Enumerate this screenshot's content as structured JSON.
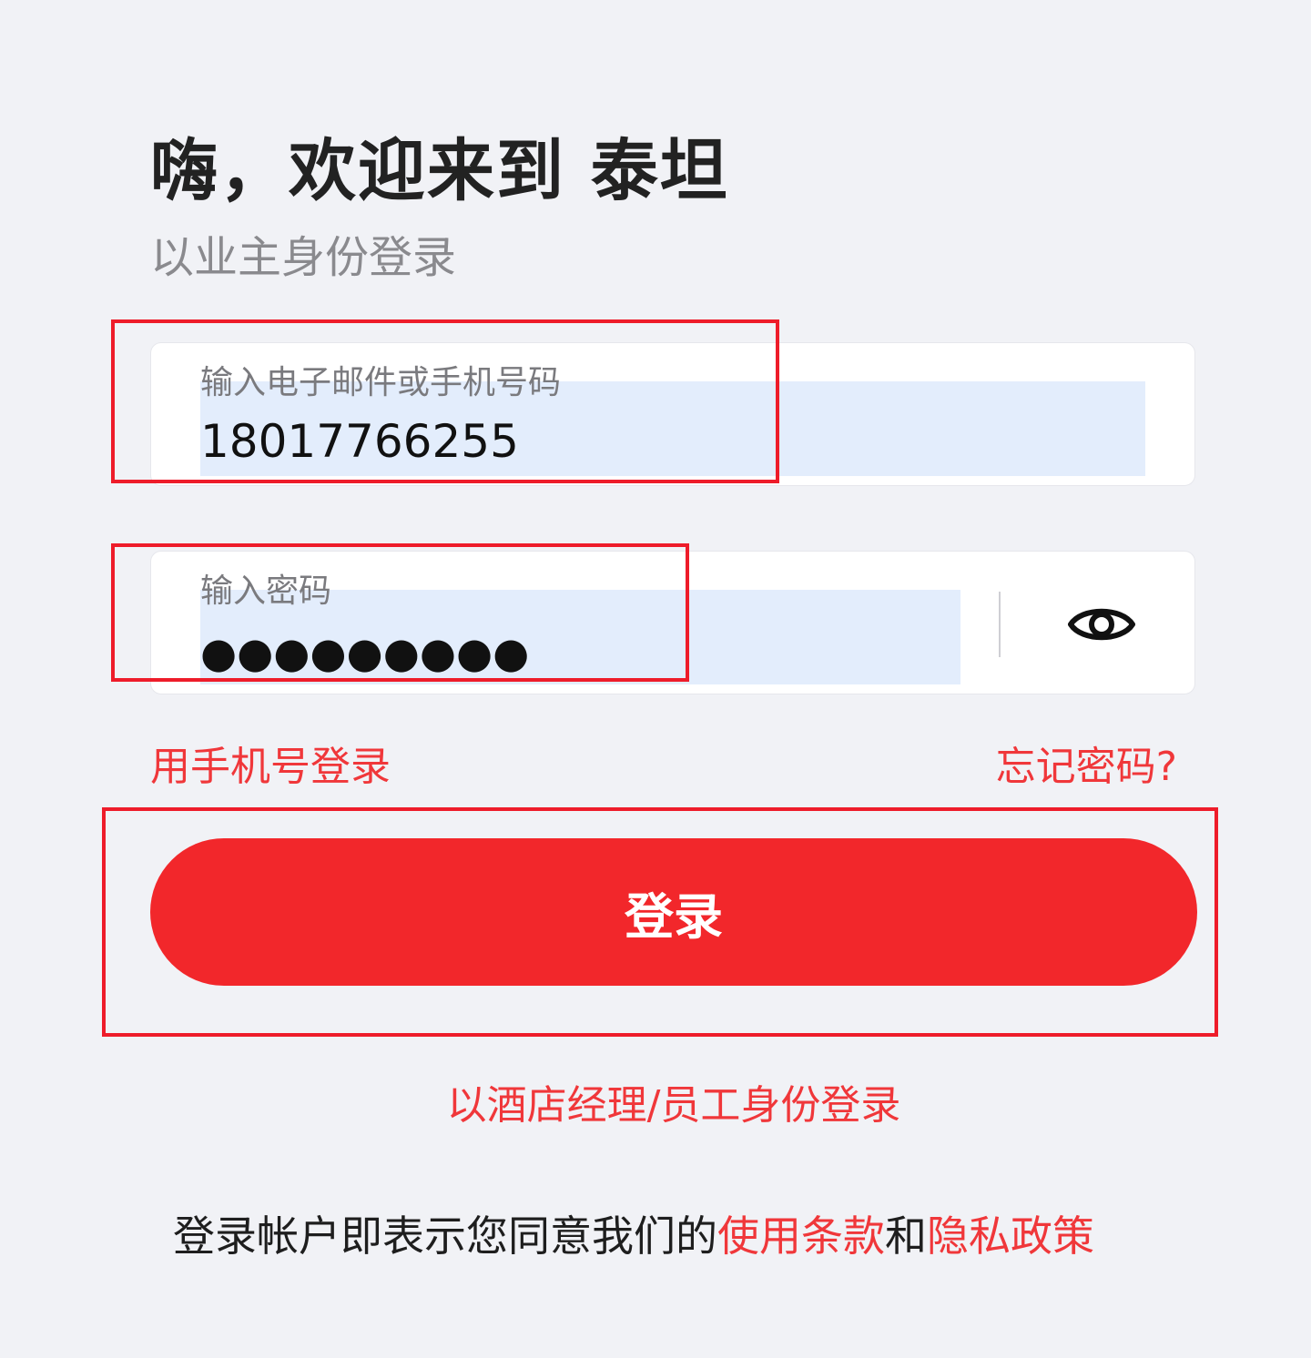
{
  "header": {
    "title": "嗨，欢迎来到 泰坦",
    "subtitle": "以业主身份登录"
  },
  "account_field": {
    "label": "输入电子邮件或手机号码",
    "value": "18017766255"
  },
  "password_field": {
    "label": "输入密码",
    "value": "●●●●●●●●●",
    "toggle_icon": "eye-icon"
  },
  "links": {
    "phone_login": "用手机号登录",
    "forgot_password": "忘记密码?"
  },
  "login_button": {
    "label": "登录"
  },
  "manager_login": {
    "label": "以酒店经理/员工身份登录"
  },
  "agreement": {
    "prefix": "登录帐户即表示您同意我们的",
    "terms": "使用条款",
    "conjunction": "和",
    "privacy": "隐私政策"
  },
  "colors": {
    "accent": "#f2272b",
    "link": "#f0373a",
    "background": "#f1f2f6",
    "autofill": "#e3edfc"
  }
}
